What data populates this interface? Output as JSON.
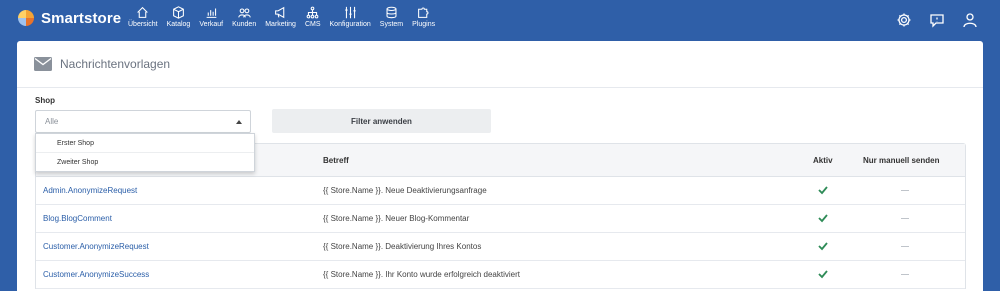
{
  "brand": {
    "name": "Smartstore"
  },
  "nav": [
    {
      "label": "Übersicht",
      "icon": "home-icon"
    },
    {
      "label": "Katalog",
      "icon": "box-icon"
    },
    {
      "label": "Verkauf",
      "icon": "bar-chart-icon"
    },
    {
      "label": "Kunden",
      "icon": "users-icon"
    },
    {
      "label": "Marketing",
      "icon": "megaphone-icon"
    },
    {
      "label": "CMS",
      "icon": "sitemap-icon"
    },
    {
      "label": "Konfiguration",
      "icon": "sliders-icon"
    },
    {
      "label": "System",
      "icon": "database-icon"
    },
    {
      "label": "Plugins",
      "icon": "puzzle-icon"
    }
  ],
  "topbar_icons": [
    "settings-icon",
    "chat-icon",
    "user-icon"
  ],
  "page": {
    "title": "Nachrichtenvorlagen",
    "icon": "envelope-icon"
  },
  "filter": {
    "shop_label": "Shop",
    "shop_value": "Alle",
    "shop_options": [
      "Erster Shop",
      "Zweiter Shop"
    ],
    "apply_label": "Filter anwenden"
  },
  "table": {
    "headers": {
      "subject": "Betreff",
      "active": "Aktiv",
      "manual": "Nur manuell senden"
    },
    "rows": [
      {
        "name": "Admin.AnonymizeRequest",
        "subject": "{{ Store.Name }}. Neue Deaktivierungsanfrage",
        "active": true,
        "manual": false
      },
      {
        "name": "Blog.BlogComment",
        "subject": "{{ Store.Name }}. Neuer Blog-Kommentar",
        "active": true,
        "manual": false
      },
      {
        "name": "Customer.AnonymizeRequest",
        "subject": "{{ Store.Name }}. Deaktivierung Ihres Kontos",
        "active": true,
        "manual": false
      },
      {
        "name": "Customer.AnonymizeSuccess",
        "subject": "{{ Store.Name }}. Ihr Konto wurde erfolgreich deaktiviert",
        "active": true,
        "manual": false
      }
    ]
  },
  "colors": {
    "primary": "#2f5fa8",
    "link": "#2a5ea8",
    "check": "#2e8b57"
  }
}
